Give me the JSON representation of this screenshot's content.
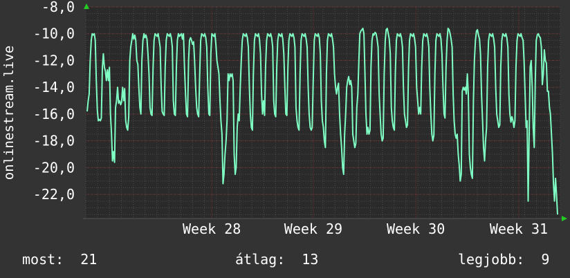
{
  "chart_data": {
    "type": "line",
    "ylabel": "onlinestream.live",
    "ylim": [
      -23.8,
      -8.0
    ],
    "y_ticks": [
      {
        "value": -8.0,
        "label": "-8,0"
      },
      {
        "value": -10.0,
        "label": "-10,0"
      },
      {
        "value": -12.0,
        "label": "-12,0"
      },
      {
        "value": -14.0,
        "label": "-14,0"
      },
      {
        "value": -16.0,
        "label": "-16,0"
      },
      {
        "value": -18.0,
        "label": "-18,0"
      },
      {
        "value": -20.0,
        "label": "-20,0"
      },
      {
        "value": -22.0,
        "label": "-22,0"
      }
    ],
    "x_ticks": [
      {
        "pos": 0.2655,
        "label": "Week 28"
      },
      {
        "pos": 0.4795,
        "label": "Week 29"
      },
      {
        "pos": 0.6955,
        "label": "Week 30"
      },
      {
        "pos": 0.9125,
        "label": "Week 31"
      }
    ],
    "grid": true,
    "line_color": "#7fffc4",
    "series": [
      {
        "values": [
          -15.8,
          -15.0,
          -14.5,
          -12.0,
          -10.5,
          -10.0,
          -10.1,
          -10.0,
          -10.5,
          -13.5,
          -15.7,
          -16.5,
          -16.4,
          -16.5,
          -16.3,
          -12.5,
          -11.5,
          -12.5,
          -12.8,
          -13.5,
          -12.7,
          -13.5,
          -12.5,
          -16.0,
          -17.5,
          -19.5,
          -18.8,
          -19.6,
          -15.5,
          -15.0,
          -14.0,
          -15.2,
          -15.0,
          -15.3,
          -15.1,
          -14.0,
          -15.0,
          -14.1,
          -16.5,
          -17.0,
          -17.2,
          -16.2,
          -12.0,
          -11.0,
          -10.5,
          -10.0,
          -10.4,
          -10.1,
          -10.5,
          -12.0,
          -12.3,
          -14.0,
          -15.5,
          -16.0,
          -12.0,
          -10.5,
          -10.0,
          -10.3,
          -10.1,
          -10.4,
          -11.5,
          -13.0,
          -15.5,
          -16.0,
          -16.1,
          -12.5,
          -10.5,
          -10.0,
          -10.1,
          -10.2,
          -10.0,
          -10.5,
          -11.0,
          -14.0,
          -15.8,
          -16.0,
          -16.1,
          -12.5,
          -10.5,
          -10.0,
          -10.1,
          -10.2,
          -10.0,
          -10.3,
          -11.0,
          -15.0,
          -16.0,
          -16.1,
          -12.5,
          -10.5,
          -10.0,
          -10.2,
          -10.1,
          -10.0,
          -10.4,
          -10.0,
          -12.5,
          -14.5,
          -16.0,
          -16.2,
          -12.0,
          -10.5,
          -10.3,
          -10.5,
          -10.8,
          -10.6,
          -12.0,
          -14.0,
          -15.5,
          -16.0,
          -16.2,
          -13.0,
          -10.5,
          -10.0,
          -10.1,
          -10.2,
          -10.0,
          -10.3,
          -11.0,
          -14.0,
          -16.0,
          -16.1,
          -11.5,
          -10.0,
          -10.1,
          -10.2,
          -10.0,
          -10.8,
          -12.0,
          -12.5,
          -13.0,
          -15.0,
          -16.5,
          -17.5,
          -21.2,
          -20.5,
          -19.0,
          -18.0,
          -16.5,
          -13.0,
          -13.5,
          -13.0,
          -13.2,
          -13.0,
          -13.5,
          -19.0,
          -20.5,
          -20.0,
          -17.0,
          -16.0,
          -16.5,
          -14.0,
          -12.0,
          -10.5,
          -10.0,
          -10.1,
          -10.2,
          -10.0,
          -10.3,
          -11.0,
          -14.0,
          -16.0,
          -17.0,
          -17.2,
          -13.0,
          -10.5,
          -10.0,
          -10.1,
          -10.2,
          -10.0,
          -10.4,
          -11.5,
          -14.5,
          -16.0,
          -15.0,
          -16.1,
          -12.5,
          -10.5,
          -10.0,
          -10.1,
          -10.2,
          -10.0,
          -10.3,
          -11.0,
          -15.0,
          -16.0,
          -16.2,
          -12.5,
          -10.5,
          -10.0,
          -10.1,
          -10.2,
          -10.0,
          -10.4,
          -11.5,
          -14.0,
          -16.0,
          -16.1,
          -12.5,
          -10.5,
          -10.0,
          -10.1,
          -10.2,
          -10.0,
          -10.3,
          -11.0,
          -15.5,
          -16.5,
          -17.0,
          -17.2,
          -13.0,
          -10.5,
          -10.0,
          -10.1,
          -10.2,
          -10.0,
          -10.4,
          -11.0,
          -14.0,
          -16.0,
          -17.0,
          -17.2,
          -17.0,
          -13.5,
          -10.5,
          -10.0,
          -10.1,
          -10.2,
          -10.0,
          -10.3,
          -11.5,
          -15.0,
          -16.5,
          -17.0,
          -18.0,
          -18.5,
          -13.0,
          -10.5,
          -10.0,
          -10.1,
          -10.2,
          -10.0,
          -10.4,
          -11.0,
          -13.0,
          -14.0,
          -14.5,
          -14.0,
          -13.7,
          -16.0,
          -17.5,
          -18.5,
          -20.0,
          -20.5,
          -17.5,
          -16.0,
          -14.0,
          -13.5,
          -13.2,
          -13.8,
          -13.5,
          -14.0,
          -17.5,
          -18.0,
          -18.5,
          -18.2,
          -15.5,
          -14.5,
          -12.0,
          -10.0,
          -9.8,
          -9.7,
          -9.6,
          -10.0,
          -13.0,
          -16.0,
          -17.5,
          -17.0,
          -17.5,
          -17.2,
          -12.5,
          -10.5,
          -10.0,
          -10.1,
          -9.9,
          -10.0,
          -10.4,
          -11.0,
          -14.5,
          -16.0,
          -17.5,
          -18.0,
          -17.8,
          -13.0,
          -10.5,
          -9.7,
          -9.6,
          -10.0,
          -10.4,
          -11.5,
          -15.5,
          -16.5,
          -17.0,
          -17.2,
          -13.0,
          -10.5,
          -10.0,
          -10.1,
          -10.2,
          -10.0,
          -10.3,
          -11.0,
          -14.0,
          -16.0,
          -16.5,
          -17.0,
          -16.8,
          -12.5,
          -10.5,
          -10.0,
          -10.1,
          -10.2,
          -10.0,
          -10.4,
          -11.0,
          -14.0,
          -15.0,
          -16.0,
          -15.5,
          -16.0,
          -12.5,
          -10.5,
          -10.0,
          -10.1,
          -10.2,
          -10.0,
          -10.3,
          -11.0,
          -14.0,
          -16.0,
          -17.5,
          -18.0,
          -17.6,
          -13.0,
          -10.5,
          -10.0,
          -10.1,
          -10.2,
          -10.0,
          -10.4,
          -11.5,
          -14.0,
          -16.0,
          -16.3,
          -12.5,
          -10.5,
          -9.6,
          -9.7,
          -10.0,
          -10.4,
          -11.0,
          -14.5,
          -16.5,
          -17.5,
          -17.8,
          -17.5,
          -19.0,
          -19.8,
          -21.0,
          -20.5,
          -14.3,
          -14.0,
          -14.2,
          -14.0,
          -14.5,
          -13.0,
          -14.5,
          -19.0,
          -20.0,
          -20.5,
          -20.8,
          -15.0,
          -12.0,
          -10.5,
          -9.8,
          -9.7,
          -10.1,
          -10.4,
          -11.5,
          -14.5,
          -16.5,
          -18.5,
          -19.5,
          -18.0,
          -17.0,
          -12.5,
          -10.5,
          -10.0,
          -10.1,
          -10.2,
          -10.0,
          -10.4,
          -11.0,
          -14.0,
          -16.0,
          -16.5,
          -17.0,
          -16.8,
          -12.5,
          -10.5,
          -10.0,
          -10.1,
          -10.2,
          -10.0,
          -10.3,
          -11.0,
          -14.5,
          -16.0,
          -16.6,
          -16.2,
          -16.5,
          -17.0,
          -16.5,
          -12.5,
          -10.5,
          -10.0,
          -10.1,
          -10.2,
          -10.0,
          -10.3,
          -10.5,
          -12.0,
          -14.5,
          -17.0,
          -16.5,
          -22.5,
          -17.5,
          -12.5,
          -12.0,
          -14.0,
          -17.0,
          -18.5,
          -13.5,
          -10.5,
          -10.1,
          -10.0,
          -10.2,
          -10.3,
          -11.0,
          -13.8,
          -13.0,
          -11.2,
          -12.0,
          -12.2,
          -14.3,
          -14.3,
          -15.5,
          -16.0,
          -17.5,
          -19.0,
          -21.2,
          -22.5,
          -20.8,
          -22.0,
          -23.5
        ]
      }
    ],
    "stats": {
      "now_label": "most:",
      "now_value": "21",
      "avg_label": "átlag:",
      "avg_value": "13",
      "best_label": "legjobb:",
      "best_value": "9"
    }
  }
}
